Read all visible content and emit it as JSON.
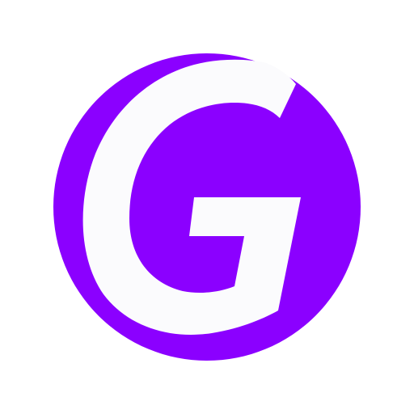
{
  "logo": {
    "letter": "G",
    "circle_color": "#8b00ff",
    "letter_color": "#fbfbfd",
    "background_color": "#ffffff"
  }
}
